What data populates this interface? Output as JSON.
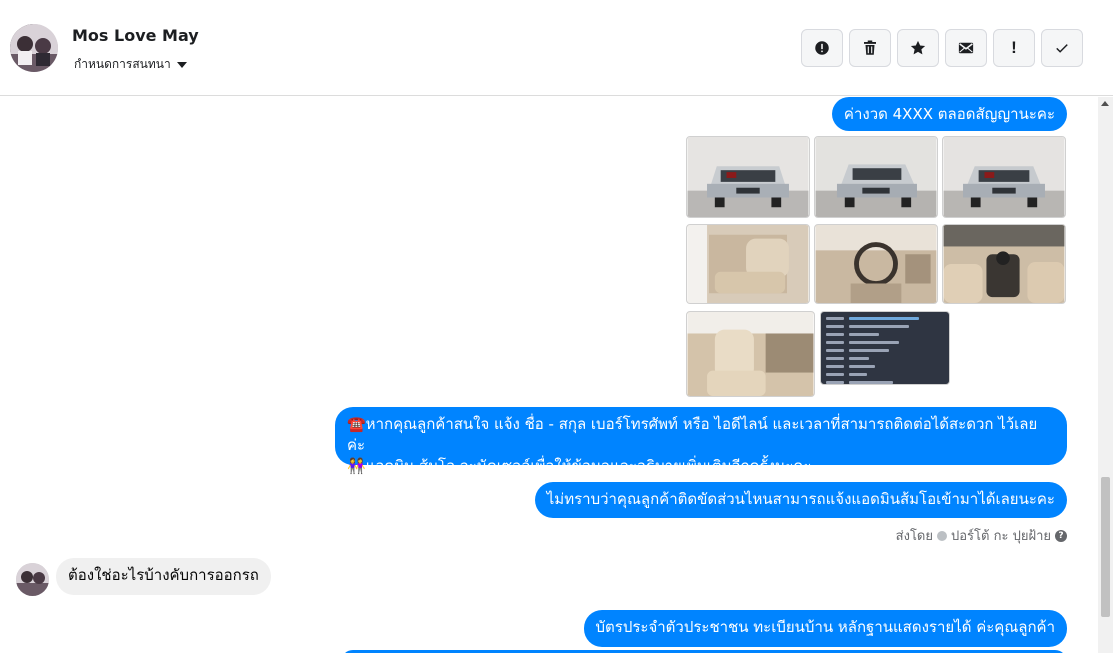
{
  "header": {
    "contact_name": "Mos Love May",
    "label_dropdown": "กำหนดการสนทนา",
    "actions": [
      {
        "icon": "alert-circle-icon"
      },
      {
        "icon": "trash-icon"
      },
      {
        "icon": "star-icon"
      },
      {
        "icon": "mail-icon"
      },
      {
        "icon": "exclamation-icon",
        "text": "!"
      },
      {
        "icon": "checkmark-icon"
      }
    ]
  },
  "thread": {
    "msg_installment": "ค่างวด 4XXX ตลอดสัญญานะคะ",
    "msg_contact_line1": "☎️หากคุณลูกค้าสนใจ แจ้ง ชื่อ - สกุล เบอร์โทรศัพท์ หรือ ไอดีไลน์ และเวลาที่สามารถติดต่อได้สะดวก ไว้เลยค่ะ",
    "msg_contact_line2": "👭แอดมิน ส้มโอ จะนัดเซลล์เพื่อให้ข้อมูลและอธิบายเพิ่มเติมอีกครั้งนะคะ",
    "msg_ask_problem": "ไม่ทราบว่าคุณลูกค้าติดขัดส่วนไหนสามารถแจ้งแอดมินส้มโอเข้ามาได้เลยนะคะ",
    "sent_by_prefix": "ส่งโดย",
    "sent_by_name": "ปอร์โต้ กะ ปุยฝ้าย",
    "msg_incoming": "ต้องใช่อะไรบ้างคับการออกรถ",
    "msg_documents": "บัตรประจำตัวประชาชน ทะเบียนบ้าน หลักฐานแสดงรายได้ ค่ะคุณลูกค้า"
  },
  "colors": {
    "outgoing_bubble": "#0084ff",
    "incoming_bubble": "#f0f0f0",
    "secondary_text": "#65676b"
  }
}
